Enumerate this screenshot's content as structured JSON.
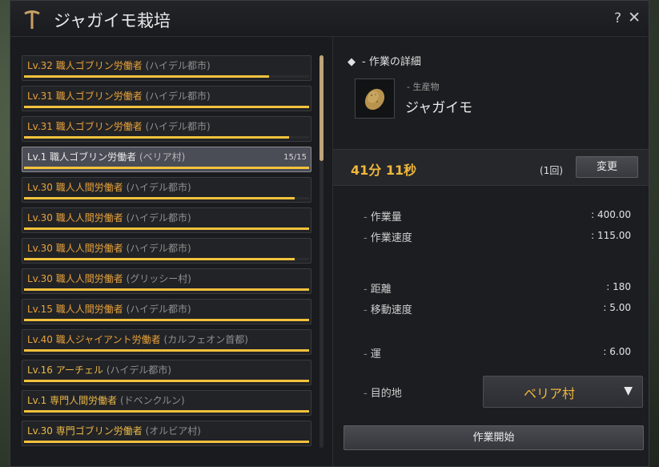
{
  "window": {
    "title": "ジャガイモ栽培",
    "help_label": "?",
    "close_label": "✕",
    "title_icon": "pickaxe-icon"
  },
  "workers": [
    {
      "level": "Lv.32 職人ゴブリン労働者",
      "location": "(ハイデル都市)",
      "stamina": 0.86,
      "selected": false,
      "amber": false
    },
    {
      "level": "Lv.31 職人ゴブリン労働者",
      "location": "(ハイデル都市)",
      "stamina": 1.0,
      "selected": false,
      "amber": false
    },
    {
      "level": "Lv.31 職人ゴブリン労働者",
      "location": "(ハイデル都市)",
      "stamina": 0.93,
      "selected": false,
      "amber": false
    },
    {
      "level": "Lv.1 職人ゴブリン労働者",
      "location": "(ベリア村)",
      "stamina": 1.0,
      "stamina_text": "15/15",
      "selected": true,
      "amber": false
    },
    {
      "level": "Lv.30 職人人間労働者",
      "location": "(ハイデル都市)",
      "stamina": 0.95,
      "selected": false,
      "amber": false
    },
    {
      "level": "Lv.30 職人人間労働者",
      "location": "(ハイデル都市)",
      "stamina": 1.0,
      "selected": false,
      "amber": false
    },
    {
      "level": "Lv.30 職人人間労働者",
      "location": "(ハイデル都市)",
      "stamina": 0.95,
      "selected": false,
      "amber": false
    },
    {
      "level": "Lv.30 職人人間労働者",
      "location": "(グリッシー村)",
      "stamina": 1.0,
      "selected": false,
      "amber": false
    },
    {
      "level": "Lv.15 職人人間労働者",
      "location": "(ハイデル都市)",
      "stamina": 1.0,
      "selected": false,
      "amber": false
    },
    {
      "level": "Lv.40 職人ジャイアント労働者",
      "location": "(カルフェオン首都)",
      "stamina": 1.0,
      "selected": false,
      "amber": false
    },
    {
      "level": "Lv.16 アーチェル",
      "location": "(ハイデル都市)",
      "stamina": 1.0,
      "selected": false,
      "amber": true
    },
    {
      "level": "Lv.1 専門人間労働者",
      "location": "(ドベンクルン)",
      "stamina": 1.0,
      "selected": false,
      "amber": true
    },
    {
      "level": "Lv.30 専門ゴブリン労働者",
      "location": "(オルビア村)",
      "stamina": 1.0,
      "selected": false,
      "amber": true
    }
  ],
  "details": {
    "section_title": "- 作業の詳細",
    "section_bullet": "◆",
    "product_category": "- 生産物",
    "product_name": "ジャガイモ",
    "product_icon": "potato-icon",
    "time": "41分 11秒",
    "count": "(1回)",
    "change_label": "変更",
    "stats": [
      {
        "label": "作業量",
        "value": ": 400.00"
      },
      {
        "label": "作業速度",
        "value": ": 115.00"
      },
      {
        "label": "距離",
        "value": ": 180"
      },
      {
        "label": "移動速度",
        "value": ": 5.00"
      },
      {
        "label": "運",
        "value": ": 6.00"
      }
    ],
    "destination_label": "目的地",
    "destination_value": "ベリア村",
    "start_label": "作業開始"
  },
  "colors": {
    "accent": "#f0b73c",
    "stamina_bar": "#f3c23c",
    "worker_level": "#e8a23a"
  }
}
